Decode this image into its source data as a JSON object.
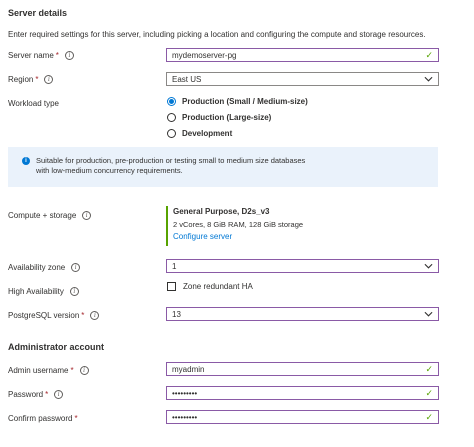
{
  "server_details": {
    "heading": "Server details",
    "description": "Enter required settings for this server, including picking a location and configuring the compute and storage resources."
  },
  "server_name": {
    "label": "Server name",
    "required": "*",
    "value": "mydemoserver-pg"
  },
  "region": {
    "label": "Region",
    "required": "*",
    "value": "East US"
  },
  "workload": {
    "label": "Workload type",
    "options": [
      "Production (Small / Medium-size)",
      "Production (Large-size)",
      "Development"
    ],
    "selected_index": 0
  },
  "info_box": {
    "text": "Suitable for production, pre-production or testing small to medium size databases with low-medium concurrency requirements."
  },
  "compute_storage": {
    "label": "Compute + storage",
    "tier": "General Purpose, D2s_v3",
    "specs": "2 vCores, 8 GiB RAM, 128 GiB storage",
    "link": "Configure server"
  },
  "availability_zone": {
    "label": "Availability zone",
    "value": "1"
  },
  "high_availability": {
    "label": "High Availability",
    "checkbox_label": "Zone redundant HA",
    "checked": false
  },
  "postgres_version": {
    "label": "PostgreSQL version",
    "required": "*",
    "value": "13"
  },
  "admin": {
    "heading": "Administrator account",
    "username_label": "Admin username",
    "username_value": "myadmin",
    "password_label": "Password",
    "password_value": "•••••••••",
    "confirm_label": "Confirm password",
    "confirm_value": "•••••••••",
    "required": "*"
  },
  "colors": {
    "accent": "#0078d4",
    "valid": "#57a300",
    "border": "#8a5aa6",
    "required": "#a4262c",
    "info_bg": "#eaf2fb"
  },
  "icons": {
    "info": "info-icon",
    "valid": "checkmark-icon",
    "dropdown": "chevron-down-icon"
  }
}
